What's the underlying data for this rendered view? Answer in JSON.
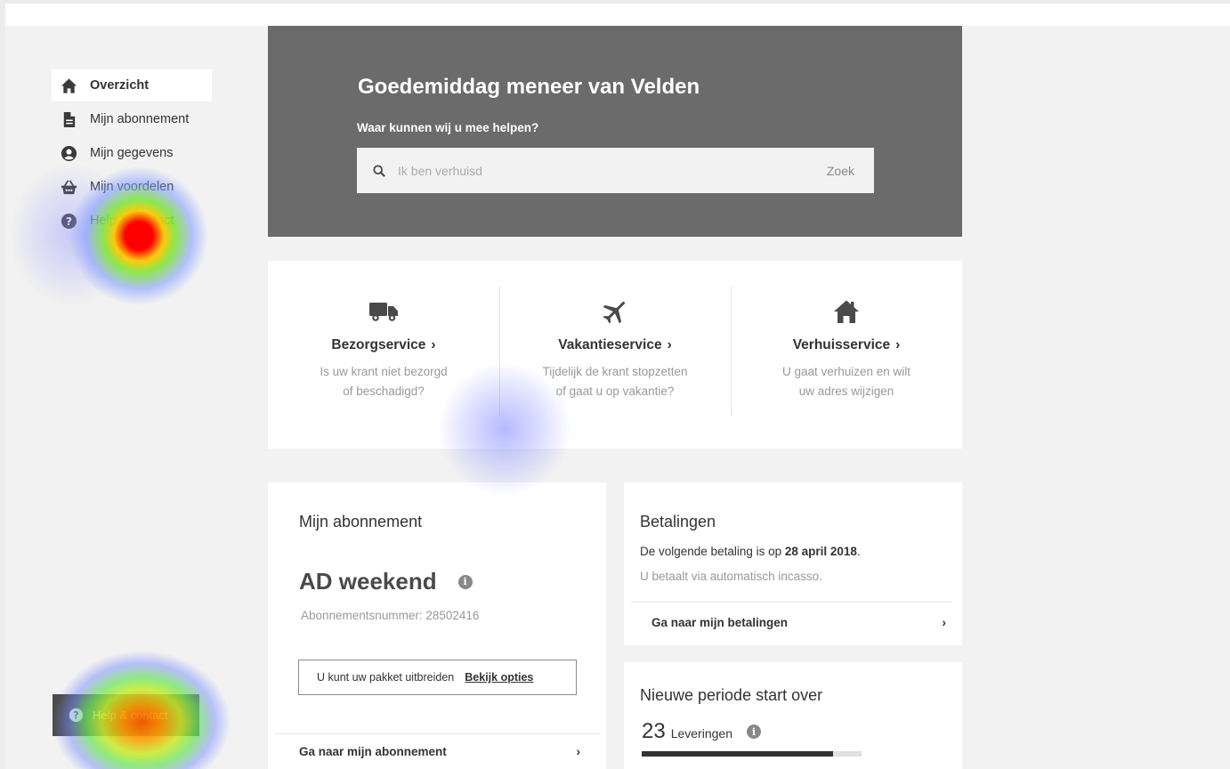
{
  "sidebar": {
    "items": [
      {
        "label": "Overzicht",
        "icon": "home-icon",
        "active": true
      },
      {
        "label": "Mijn abonnement",
        "icon": "document-icon",
        "active": false
      },
      {
        "label": "Mijn gegevens",
        "icon": "user-circle-icon",
        "active": false
      },
      {
        "label": "Mijn voordelen",
        "icon": "basket-icon",
        "active": false
      },
      {
        "label": "Help & contact",
        "icon": "question-circle-icon",
        "active": false
      }
    ]
  },
  "hero": {
    "title": "Goedemiddag meneer van Velden",
    "subtitle": "Waar kunnen wij u mee helpen?",
    "search_placeholder": "Ik ben verhuisd",
    "search_button": "Zoek",
    "background": "#6b6b6b"
  },
  "services": [
    {
      "title": "Bezorgservice",
      "desc_line1": "Is uw krant niet bezorgd",
      "desc_line2": "of beschadigd?",
      "icon": "truck-icon"
    },
    {
      "title": "Vakantieservice",
      "desc_line1": "Tijdelijk de krant stopzetten",
      "desc_line2": "of gaat u op vakantie?",
      "icon": "airplane-icon"
    },
    {
      "title": "Verhuisservice",
      "desc_line1": "U gaat verhuizen en wilt",
      "desc_line2": "uw adres wijzigen",
      "icon": "house-icon"
    }
  ],
  "subscription": {
    "heading": "Mijn abonnement",
    "name": "AD weekend",
    "number_text": "Abonnementsnummer: 28502416",
    "upgrade_text": "U kunt uw pakket uitbreiden",
    "upgrade_link": "Bekijk opties",
    "link": "Ga naar mijn abonnement"
  },
  "payments": {
    "heading": "Betalingen",
    "next_prefix": "De volgende betaling is op ",
    "next_date": "28 april 2018",
    "next_suffix": ".",
    "method": "U betaalt via automatisch incasso.",
    "link": "Ga naar mijn betalingen"
  },
  "new_period": {
    "heading": "Nieuwe periode start over",
    "count": "23",
    "unit": "Leveringen",
    "progress": 0.87
  },
  "help_button": {
    "label": "Help & contact",
    "icon": "question-circle-icon"
  },
  "heatmap_hotspots": [
    {
      "target": "sidebar-item-help",
      "intensity": "high"
    },
    {
      "target": "help-contact-button",
      "intensity": "high"
    },
    {
      "target": "vakantieservice",
      "intensity": "low"
    },
    {
      "target": "sidebar-item-help",
      "intensity": "low"
    }
  ]
}
